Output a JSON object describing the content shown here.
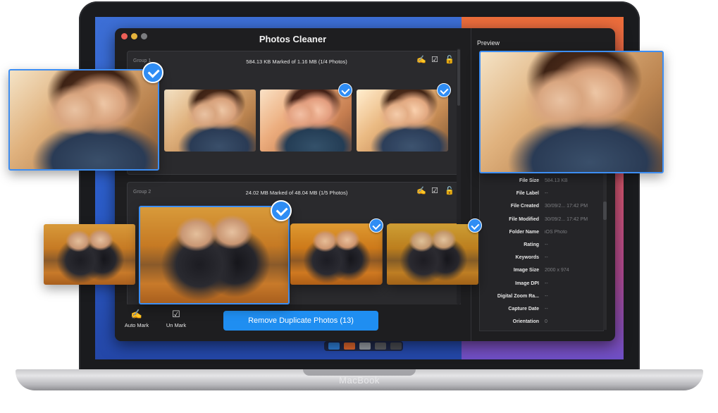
{
  "app": {
    "title": "Photos Cleaner",
    "device_label": "MacBook"
  },
  "groups": [
    {
      "label": "Group 1",
      "info": "584.13 KB Marked of 1.16 MB (1/4 Photos)"
    },
    {
      "label": "Group 2",
      "info": "24.02 MB Marked of 48.04 MB (1/5 Photos)"
    }
  ],
  "toolbar": {
    "auto_mark_label": "Auto Mark",
    "un_mark_label": "Un Mark",
    "remove_label": "Remove Duplicate Photos (13)"
  },
  "preview": {
    "title": "Preview",
    "metadata": [
      {
        "key": "File Size",
        "value": "584.13 KB"
      },
      {
        "key": "File Label",
        "value": "--"
      },
      {
        "key": "File Created",
        "value": "30/09/2... 17:42 PM"
      },
      {
        "key": "File Modified",
        "value": "30/09/2... 17:42 PM"
      },
      {
        "key": "Folder Name",
        "value": "iOS Photo"
      },
      {
        "key": "Rating",
        "value": "--"
      },
      {
        "key": "Keywords",
        "value": "--"
      },
      {
        "key": "Image Size",
        "value": "2000 x 974"
      },
      {
        "key": "Image DPI",
        "value": "--"
      },
      {
        "key": "Digital Zoom Ra...",
        "value": "--"
      },
      {
        "key": "Capture Date",
        "value": "--"
      },
      {
        "key": "Orientation",
        "value": "0"
      }
    ]
  },
  "colors": {
    "accent": "#2f8df4",
    "window_bg": "#1e1e20",
    "panel_bg": "#2a2a2d"
  },
  "icons": {
    "group_actions": [
      "auto-mark-icon",
      "checkbox-icon",
      "unlock-icon"
    ],
    "check": "checkmark-icon"
  }
}
